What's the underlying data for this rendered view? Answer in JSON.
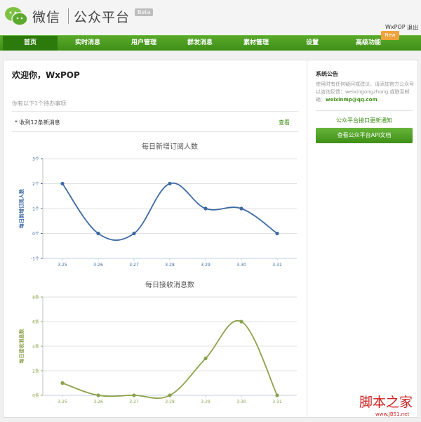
{
  "header": {
    "logo_text": "微信",
    "logo_sub": "公众平台",
    "beta": "Beta",
    "user": "WxPOP",
    "logout": "退出"
  },
  "nav": {
    "items": [
      "首页",
      "实时消息",
      "用户管理",
      "群发消息",
      "素材管理",
      "设置",
      "高级功能"
    ],
    "new_badge": "New"
  },
  "main": {
    "welcome": "欢迎你，WxPOP",
    "todo_intro": "你有以下1个待办事项:",
    "todo_item": "收到12条新消息",
    "todo_view": "查看"
  },
  "sidebar": {
    "title": "系统公告",
    "text": "使用时有任何疑问或建议，请添加官方公众号以咨询反馈：weixingongzhong 或联系邮箱：",
    "email": "weixinmp@qq.com",
    "update_link": "公众平台接口更新通知",
    "api_button": "查看公众平台API文档"
  },
  "chart_data": [
    {
      "type": "line",
      "title": "每日新增订阅人数",
      "ylabel": "每日新增订阅人数",
      "categories": [
        "3-25",
        "3-26",
        "3-27",
        "3-28",
        "3-29",
        "3-30",
        "3-31"
      ],
      "values": [
        2,
        0,
        0,
        2,
        1,
        1,
        0
      ],
      "ylim": [
        -1,
        3
      ],
      "yticks": [
        "-1个",
        "0个",
        "1个",
        "2个",
        "3个"
      ],
      "color": "#3d6aa3"
    },
    {
      "type": "line",
      "title": "每日接收消息数",
      "ylabel": "每日接收消息数",
      "categories": [
        "3-25",
        "3-26",
        "3-27",
        "3-28",
        "3-29",
        "3-30",
        "3-31"
      ],
      "values": [
        1,
        0,
        0,
        0,
        3,
        6,
        0
      ],
      "ylim": [
        0,
        8
      ],
      "yticks": [
        "0条",
        "2条",
        "4条",
        "6条",
        "8条"
      ],
      "color": "#8aa34a"
    }
  ],
  "watermark": {
    "text": "脚本之家",
    "url": "www.JB51.net"
  }
}
